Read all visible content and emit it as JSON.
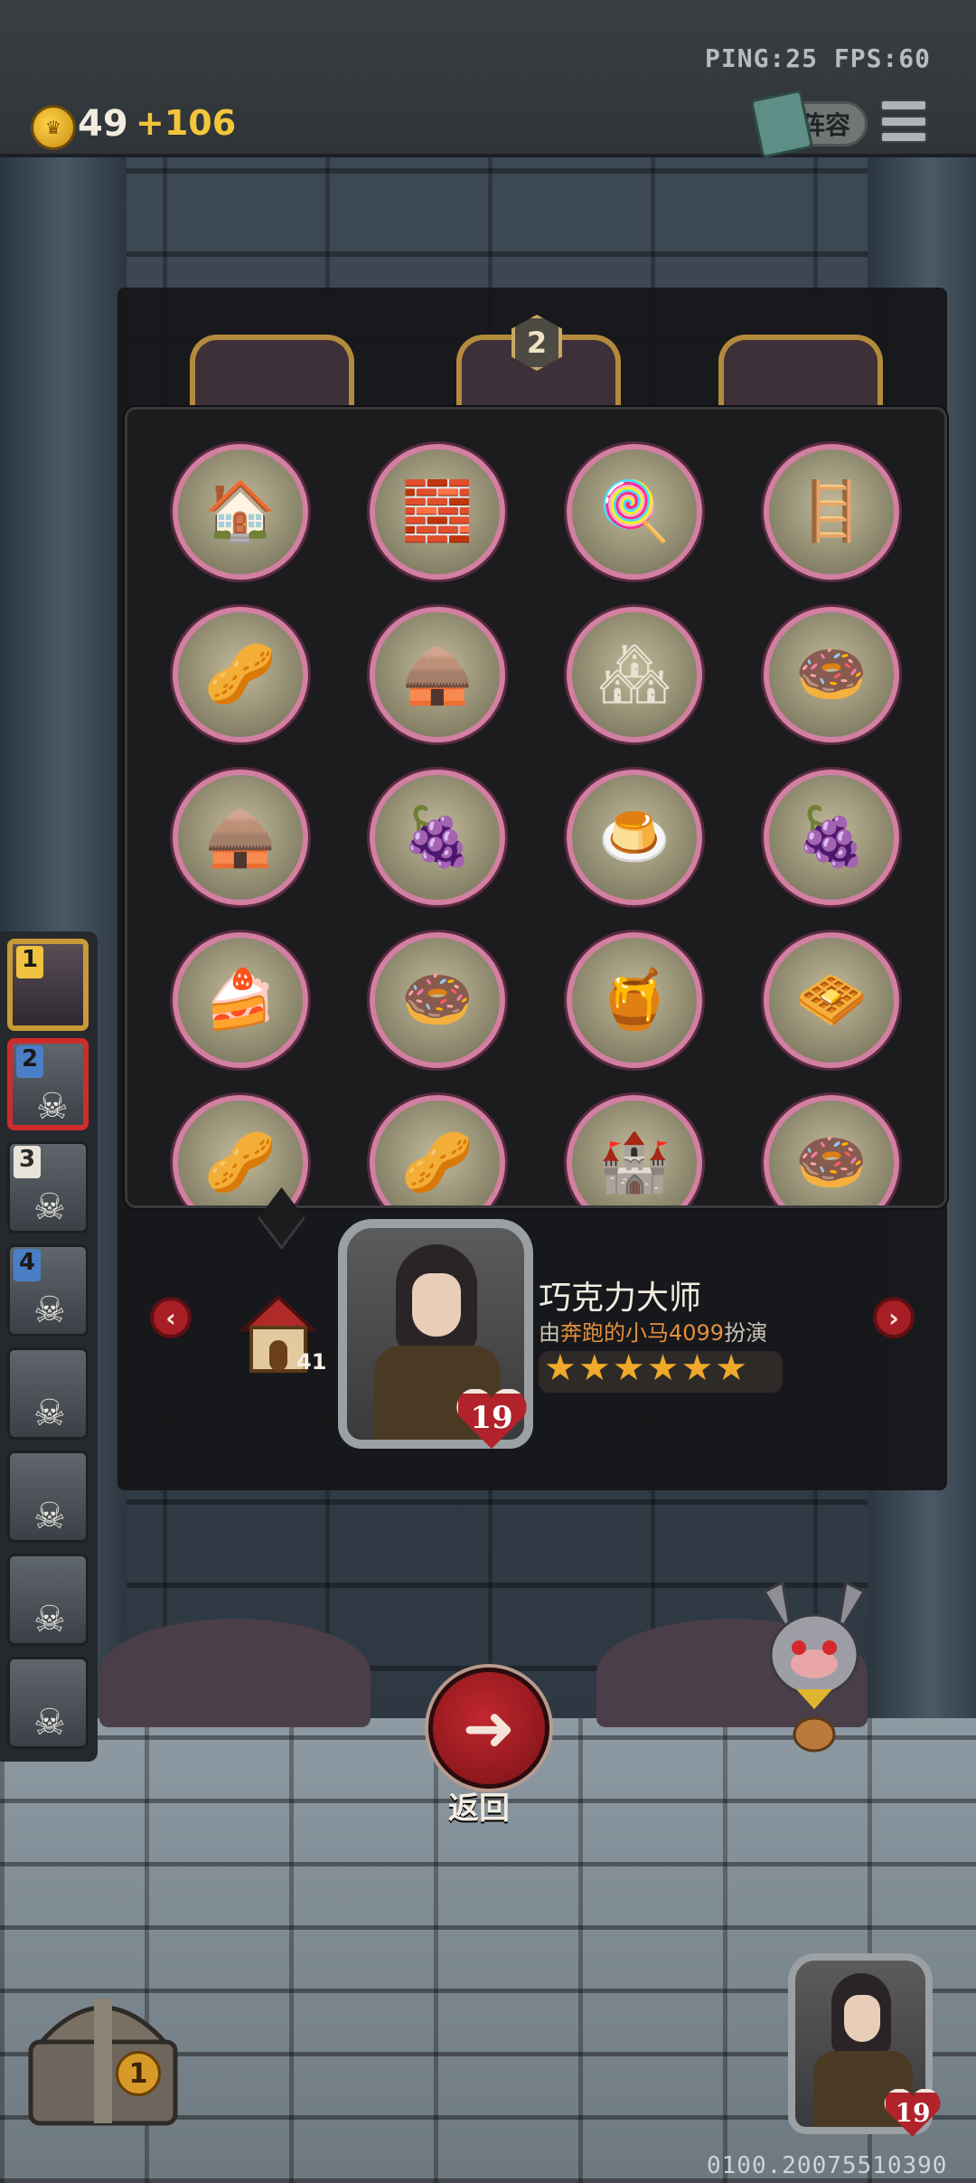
{
  "hud": {
    "ping_fps": "PING:25   FPS:60",
    "gold": "49",
    "gold_income": "+106",
    "lineup_label": "阵容"
  },
  "panel": {
    "middle_card_number": "2"
  },
  "buildings": [
    {
      "name": "orange-house",
      "glyph": "🏠"
    },
    {
      "name": "brick-oven",
      "glyph": "🧱"
    },
    {
      "name": "candy-mill",
      "glyph": "🍭"
    },
    {
      "name": "wafer-stairs",
      "glyph": "🪜"
    },
    {
      "name": "cocoa-pod",
      "glyph": "🥜"
    },
    {
      "name": "cocoa-barn",
      "glyph": "🛖"
    },
    {
      "name": "gingerbread-house",
      "glyph": "🏘"
    },
    {
      "name": "donut-cannon",
      "glyph": "🍩"
    },
    {
      "name": "cocoa-barn",
      "glyph": "🛖"
    },
    {
      "name": "grape-hospital",
      "glyph": "🍇"
    },
    {
      "name": "pudding-hut",
      "glyph": "🍮"
    },
    {
      "name": "grape-hospital",
      "glyph": "🍇"
    },
    {
      "name": "cake-stall",
      "glyph": "🍰"
    },
    {
      "name": "donut-cannon",
      "glyph": "🍩"
    },
    {
      "name": "honey-rock",
      "glyph": "🍯"
    },
    {
      "name": "wafer-stack",
      "glyph": "🧇"
    },
    {
      "name": "cocoa-pod",
      "glyph": "🥜"
    },
    {
      "name": "cocoa-pod",
      "glyph": "🥜"
    },
    {
      "name": "donut-castle",
      "glyph": "🏰"
    },
    {
      "name": "donut-cannon",
      "glyph": "🍩"
    }
  ],
  "character": {
    "building_count": "41",
    "level": "19",
    "name": "巧克力大师",
    "sub_prefix": "由",
    "player": "奔跑的小马4099",
    "sub_suffix": "扮演",
    "stars": "★★★★★★",
    "star_count": 6
  },
  "team": [
    {
      "num": "1",
      "state": "active",
      "num_color": "#f0c240"
    },
    {
      "num": "2",
      "state": "selected",
      "num_color": "#4a7fc6"
    },
    {
      "num": "3",
      "state": "dead",
      "num_color": "#e9e4da"
    },
    {
      "num": "4",
      "state": "dead",
      "num_color": "#4a7fc6"
    },
    {
      "num": "",
      "state": "dead",
      "num_color": ""
    },
    {
      "num": "",
      "state": "dead",
      "num_color": ""
    },
    {
      "num": "",
      "state": "dead",
      "num_color": ""
    },
    {
      "num": "",
      "state": "dead",
      "num_color": ""
    }
  ],
  "back_label": "返回",
  "chest_count": "1",
  "bottom_level": "19",
  "build_id": "0100.20075510390",
  "icons": {
    "coin": "coin-icon",
    "menu": "hamburger-menu-icon",
    "left_arrow": "chevron-left-icon",
    "right_arrow": "chevron-right-icon",
    "back": "back-arrow-icon",
    "skull": "skull-icon"
  },
  "colors": {
    "accent_red": "#b1222b",
    "gold": "#f3c53a",
    "building_ring": "#d27fa2"
  }
}
